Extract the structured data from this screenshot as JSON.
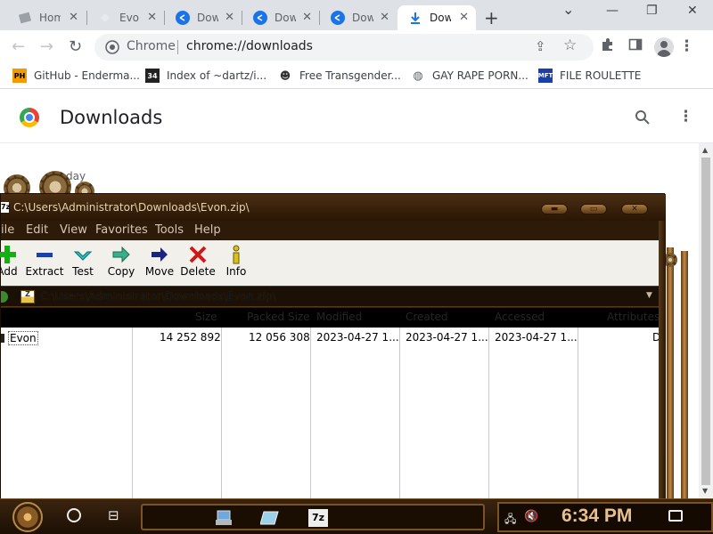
{
  "browser": {
    "tabs": [
      {
        "title": "Hom",
        "icon": "page-icon",
        "active": false
      },
      {
        "title": "Evo",
        "icon": "page-icon",
        "active": false
      },
      {
        "title": "Dow",
        "icon": "share-icon",
        "active": false
      },
      {
        "title": "Dow",
        "icon": "share-icon",
        "active": false
      },
      {
        "title": "Dow",
        "icon": "share-icon",
        "active": false
      },
      {
        "title": "Dow",
        "icon": "download-icon",
        "active": true
      }
    ],
    "omnibox": {
      "chip": "Chrome",
      "url": "chrome://downloads"
    },
    "bookmarks": [
      {
        "label": "GitHub - Enderma...",
        "icon": "ph-icon"
      },
      {
        "label": "Index of ~dartz/i...",
        "icon": "folder-icon"
      },
      {
        "label": "Free Transgender...",
        "icon": "mask-icon"
      },
      {
        "label": "GAY RAPE PORN...",
        "icon": "globe-icon"
      },
      {
        "label": "FILE ROULETTE",
        "icon": "mft-icon"
      }
    ],
    "colors": {
      "accent": "#1a73e8",
      "tabstrip": "#dee1e6"
    }
  },
  "downloads_page": {
    "title": "Downloads",
    "date_heading": "day"
  },
  "zip_window": {
    "title": "C:\\Users\\Administrator\\Downloads\\Evon.zip\\",
    "path": "C:\\Users\\Administrator\\Downloads\\Evon.zip\\",
    "menu": [
      "ile",
      "Edit",
      "View",
      "Favorites",
      "Tools",
      "Help"
    ],
    "toolbar": [
      "Add",
      "Extract",
      "Test",
      "Copy",
      "Move",
      "Delete",
      "Info"
    ],
    "columns": [
      "",
      "Size",
      "Packed Size",
      "Modified",
      "Created",
      "Accessed",
      "Attributes"
    ],
    "rows": [
      {
        "name": "Evon",
        "size": "14 252 892",
        "packed": "12 056 308",
        "modified": "2023-04-27 1...",
        "created": "2023-04-27 1...",
        "accessed": "2023-04-27 1...",
        "attr": "D"
      }
    ]
  },
  "taskbar": {
    "clock": "6:34 PM",
    "pinned_app_label": "7z"
  }
}
